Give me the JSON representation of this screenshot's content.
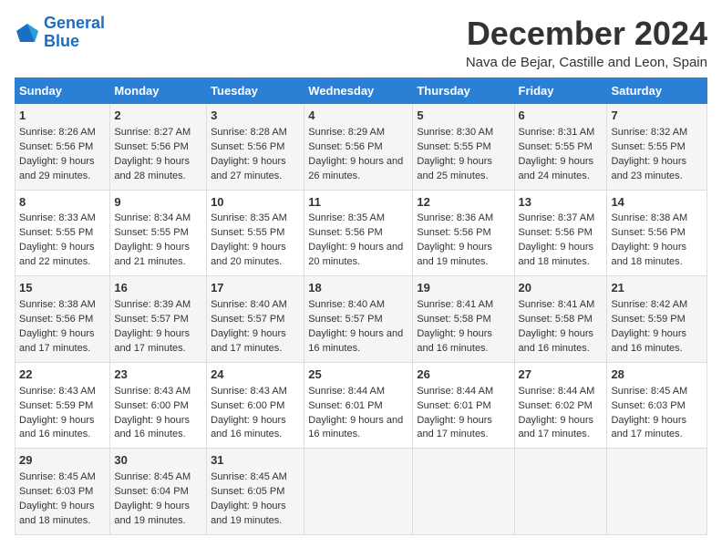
{
  "header": {
    "logo_line1": "General",
    "logo_line2": "Blue",
    "month_title": "December 2024",
    "location": "Nava de Bejar, Castille and Leon, Spain"
  },
  "columns": [
    "Sunday",
    "Monday",
    "Tuesday",
    "Wednesday",
    "Thursday",
    "Friday",
    "Saturday"
  ],
  "weeks": [
    [
      {
        "day": "1",
        "sunrise": "8:26 AM",
        "sunset": "5:56 PM",
        "daylight": "9 hours and 29 minutes."
      },
      {
        "day": "2",
        "sunrise": "8:27 AM",
        "sunset": "5:56 PM",
        "daylight": "9 hours and 28 minutes."
      },
      {
        "day": "3",
        "sunrise": "8:28 AM",
        "sunset": "5:56 PM",
        "daylight": "9 hours and 27 minutes."
      },
      {
        "day": "4",
        "sunrise": "8:29 AM",
        "sunset": "5:56 PM",
        "daylight": "9 hours and 26 minutes."
      },
      {
        "day": "5",
        "sunrise": "8:30 AM",
        "sunset": "5:55 PM",
        "daylight": "9 hours and 25 minutes."
      },
      {
        "day": "6",
        "sunrise": "8:31 AM",
        "sunset": "5:55 PM",
        "daylight": "9 hours and 24 minutes."
      },
      {
        "day": "7",
        "sunrise": "8:32 AM",
        "sunset": "5:55 PM",
        "daylight": "9 hours and 23 minutes."
      }
    ],
    [
      {
        "day": "8",
        "sunrise": "8:33 AM",
        "sunset": "5:55 PM",
        "daylight": "9 hours and 22 minutes."
      },
      {
        "day": "9",
        "sunrise": "8:34 AM",
        "sunset": "5:55 PM",
        "daylight": "9 hours and 21 minutes."
      },
      {
        "day": "10",
        "sunrise": "8:35 AM",
        "sunset": "5:55 PM",
        "daylight": "9 hours and 20 minutes."
      },
      {
        "day": "11",
        "sunrise": "8:35 AM",
        "sunset": "5:56 PM",
        "daylight": "9 hours and 20 minutes."
      },
      {
        "day": "12",
        "sunrise": "8:36 AM",
        "sunset": "5:56 PM",
        "daylight": "9 hours and 19 minutes."
      },
      {
        "day": "13",
        "sunrise": "8:37 AM",
        "sunset": "5:56 PM",
        "daylight": "9 hours and 18 minutes."
      },
      {
        "day": "14",
        "sunrise": "8:38 AM",
        "sunset": "5:56 PM",
        "daylight": "9 hours and 18 minutes."
      }
    ],
    [
      {
        "day": "15",
        "sunrise": "8:38 AM",
        "sunset": "5:56 PM",
        "daylight": "9 hours and 17 minutes."
      },
      {
        "day": "16",
        "sunrise": "8:39 AM",
        "sunset": "5:57 PM",
        "daylight": "9 hours and 17 minutes."
      },
      {
        "day": "17",
        "sunrise": "8:40 AM",
        "sunset": "5:57 PM",
        "daylight": "9 hours and 17 minutes."
      },
      {
        "day": "18",
        "sunrise": "8:40 AM",
        "sunset": "5:57 PM",
        "daylight": "9 hours and 16 minutes."
      },
      {
        "day": "19",
        "sunrise": "8:41 AM",
        "sunset": "5:58 PM",
        "daylight": "9 hours and 16 minutes."
      },
      {
        "day": "20",
        "sunrise": "8:41 AM",
        "sunset": "5:58 PM",
        "daylight": "9 hours and 16 minutes."
      },
      {
        "day": "21",
        "sunrise": "8:42 AM",
        "sunset": "5:59 PM",
        "daylight": "9 hours and 16 minutes."
      }
    ],
    [
      {
        "day": "22",
        "sunrise": "8:43 AM",
        "sunset": "5:59 PM",
        "daylight": "9 hours and 16 minutes."
      },
      {
        "day": "23",
        "sunrise": "8:43 AM",
        "sunset": "6:00 PM",
        "daylight": "9 hours and 16 minutes."
      },
      {
        "day": "24",
        "sunrise": "8:43 AM",
        "sunset": "6:00 PM",
        "daylight": "9 hours and 16 minutes."
      },
      {
        "day": "25",
        "sunrise": "8:44 AM",
        "sunset": "6:01 PM",
        "daylight": "9 hours and 16 minutes."
      },
      {
        "day": "26",
        "sunrise": "8:44 AM",
        "sunset": "6:01 PM",
        "daylight": "9 hours and 17 minutes."
      },
      {
        "day": "27",
        "sunrise": "8:44 AM",
        "sunset": "6:02 PM",
        "daylight": "9 hours and 17 minutes."
      },
      {
        "day": "28",
        "sunrise": "8:45 AM",
        "sunset": "6:03 PM",
        "daylight": "9 hours and 17 minutes."
      }
    ],
    [
      {
        "day": "29",
        "sunrise": "8:45 AM",
        "sunset": "6:03 PM",
        "daylight": "9 hours and 18 minutes."
      },
      {
        "day": "30",
        "sunrise": "8:45 AM",
        "sunset": "6:04 PM",
        "daylight": "9 hours and 19 minutes."
      },
      {
        "day": "31",
        "sunrise": "8:45 AM",
        "sunset": "6:05 PM",
        "daylight": "9 hours and 19 minutes."
      },
      null,
      null,
      null,
      null
    ]
  ]
}
